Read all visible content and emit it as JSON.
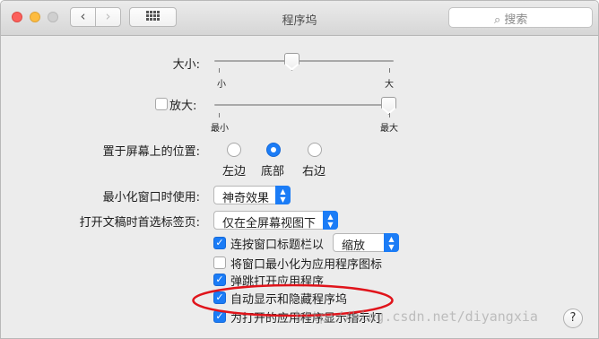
{
  "window": {
    "title": "程序坞"
  },
  "toolbar": {
    "back_icon": "‹",
    "forward_icon": "›",
    "search_placeholder": "搜索",
    "search_icon": "⌕"
  },
  "size": {
    "label": "大小:",
    "min_label": "小",
    "max_label": "大",
    "value_fraction": 0.45
  },
  "magnification": {
    "label": "放大:",
    "checked": false,
    "min_label": "最小",
    "max_label": "最大",
    "value_fraction": 1.0
  },
  "position": {
    "label": "置于屏幕上的位置:",
    "options": [
      "左边",
      "底部",
      "右边"
    ],
    "selected": "底部"
  },
  "minimize": {
    "label": "最小化窗口时使用:",
    "value": "神奇效果"
  },
  "tabs_pref": {
    "label": "打开文稿时首选标签页:",
    "value": "仅在全屏幕视图下"
  },
  "checks": {
    "double_click": {
      "label": "连按窗口标题栏以",
      "checked": true,
      "action": "缩放"
    },
    "minimize_into_icon": {
      "label": "将窗口最小化为应用程序图标",
      "checked": false
    },
    "animate": {
      "label": "弹跳打开应用程序",
      "checked": true
    },
    "autohide": {
      "label": "自动显示和隐藏程序坞",
      "checked": true
    },
    "indicators": {
      "label": "为打开的应用程序显示指示灯",
      "checked": true
    }
  },
  "check_glyph": "✓",
  "popup_arrows": "▲▼",
  "watermark": "http://blog.csdn.net/diyangxia",
  "help_glyph": "?",
  "colors": {
    "accent": "#1b7cf6",
    "annotation": "#e0141b"
  }
}
